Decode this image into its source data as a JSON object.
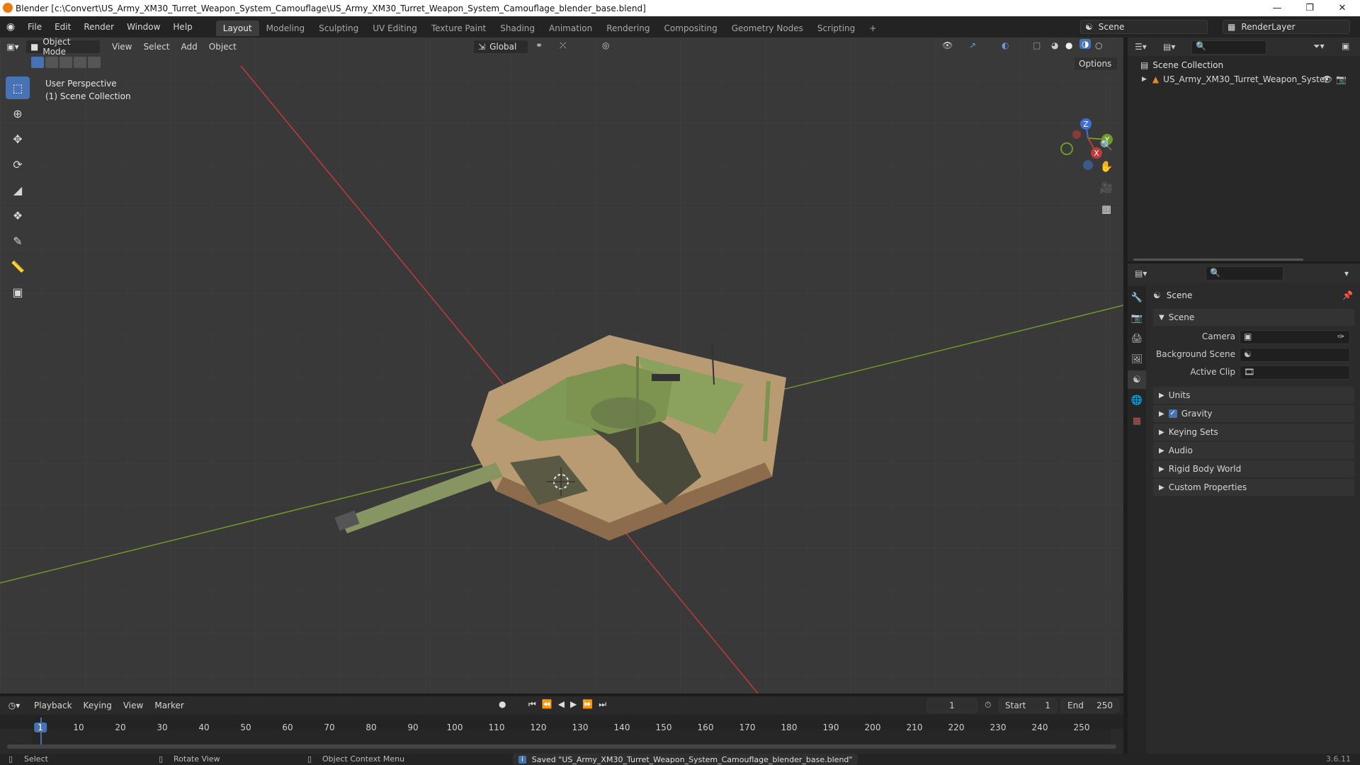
{
  "window": {
    "title": "Blender [c:\\Convert\\US_Army_XM30_Turret_Weapon_System_Camouflage\\US_Army_XM30_Turret_Weapon_System_Camouflage_blender_base.blend]"
  },
  "menu": {
    "items": [
      "File",
      "Edit",
      "Render",
      "Window",
      "Help"
    ],
    "workspaces": [
      "Layout",
      "Modeling",
      "Sculpting",
      "UV Editing",
      "Texture Paint",
      "Shading",
      "Animation",
      "Rendering",
      "Compositing",
      "Geometry Nodes",
      "Scripting"
    ],
    "add_tab": "+",
    "scene_name": "Scene",
    "view_layer": "RenderLayer"
  },
  "viewport": {
    "mode": "Object Mode",
    "menus": [
      "View",
      "Select",
      "Add",
      "Object"
    ],
    "orientation": "Global",
    "options_label": "Options",
    "overlay_title": "User Perspective",
    "overlay_subtitle": "(1) Scene Collection",
    "gizmo_axes": [
      "Z",
      "Y",
      "X"
    ]
  },
  "outliner": {
    "root": "Scene Collection",
    "items": [
      {
        "label": "US_Army_XM30_Turret_Weapon_Syster"
      }
    ]
  },
  "properties": {
    "header": "Scene",
    "section": "Scene",
    "fields": [
      {
        "label": "Camera"
      },
      {
        "label": "Background Scene"
      },
      {
        "label": "Active Clip"
      }
    ],
    "panels": [
      "Units",
      "Gravity",
      "Keying Sets",
      "Audio",
      "Rigid Body World",
      "Custom Properties"
    ],
    "gravity_checked": true
  },
  "timeline": {
    "menus": [
      "Playback",
      "Keying",
      "View",
      "Marker"
    ],
    "current_frame": "1",
    "start_label": "Start",
    "start_value": "1",
    "end_label": "End",
    "end_value": "250",
    "ticks": [
      "1",
      "10",
      "20",
      "30",
      "40",
      "50",
      "60",
      "70",
      "80",
      "90",
      "100",
      "110",
      "120",
      "130",
      "140",
      "150",
      "160",
      "170",
      "180",
      "190",
      "200",
      "210",
      "220",
      "230",
      "240",
      "250"
    ]
  },
  "status": {
    "select": "Select",
    "rotate": "Rotate View",
    "context": "Object Context Menu",
    "message": "Saved \"US_Army_XM30_Turret_Weapon_System_Camouflage_blender_base.blend\"",
    "version": "3.6.11"
  },
  "colors": {
    "accent": "#4772b3",
    "x_axis": "#c13a3a",
    "y_axis": "#6e9a2a",
    "z_axis": "#3f6fd1"
  }
}
